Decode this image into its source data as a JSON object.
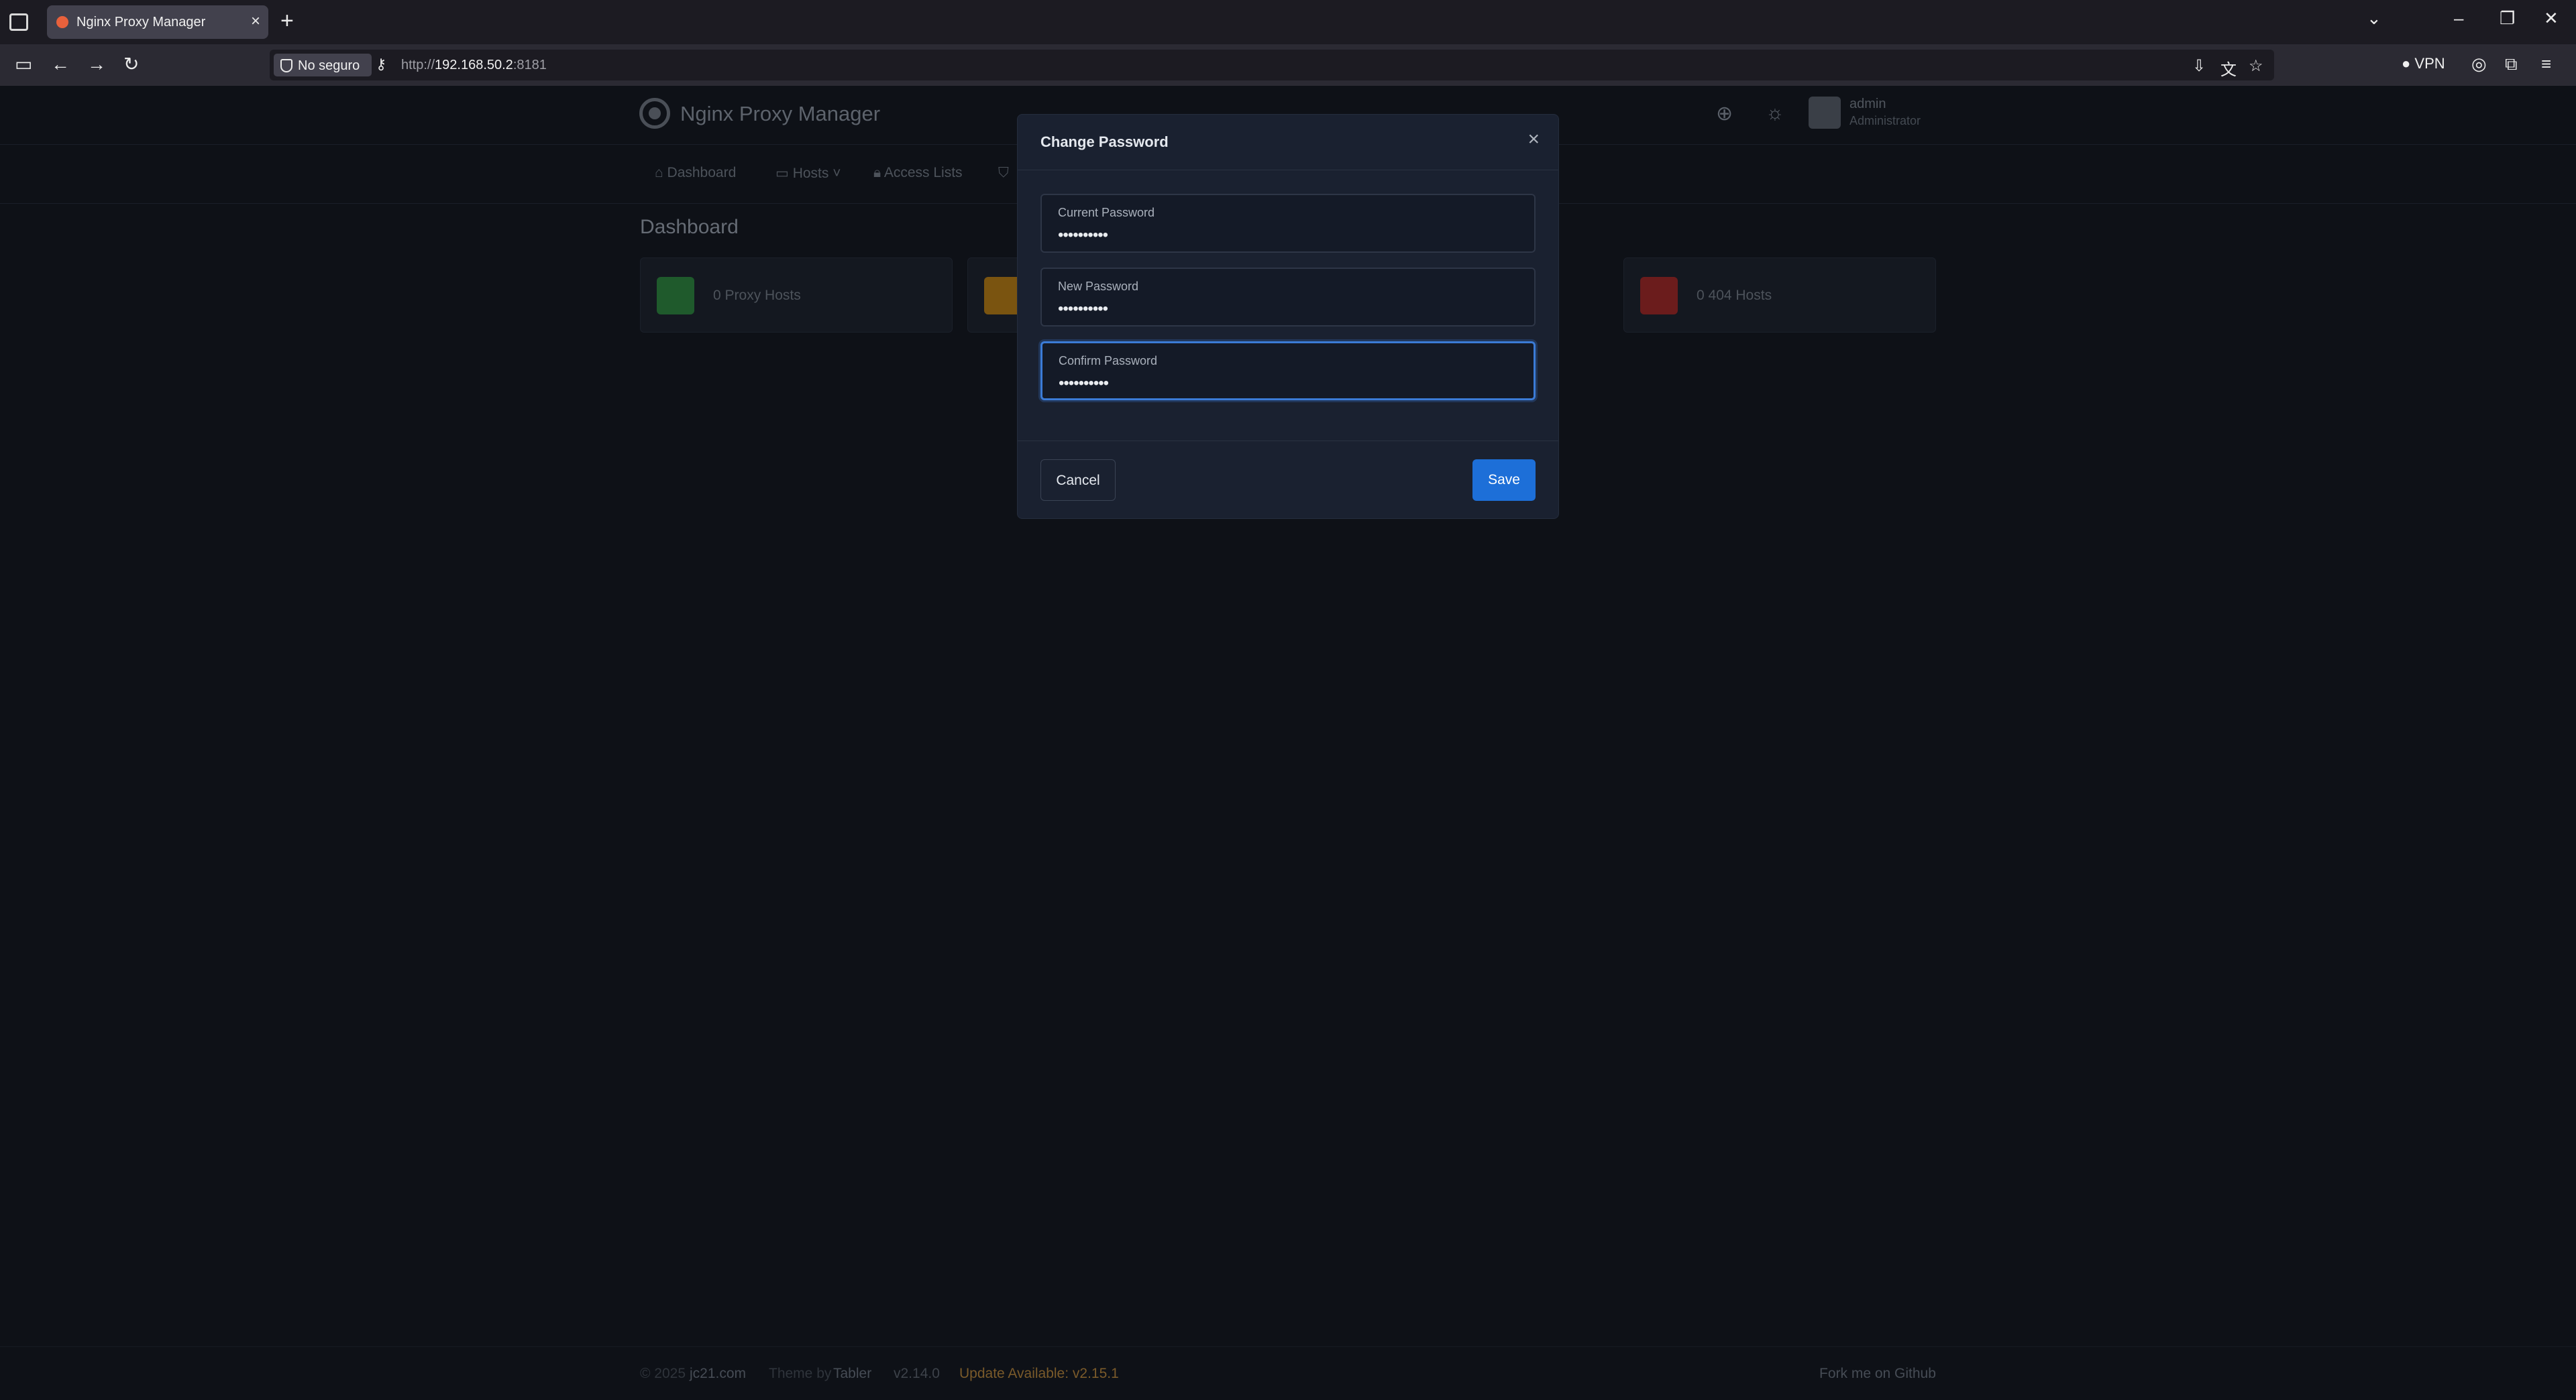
{
  "browser": {
    "tab_title": "Nginx Proxy Manager",
    "security_label": "No seguro",
    "url_prefix": "http://",
    "url_host": "192.168.50.2",
    "url_port": ":8181",
    "vpn_label": "VPN"
  },
  "app": {
    "brand": "Nginx Proxy Manager",
    "user_name": "admin",
    "user_role": "Administrator",
    "nav": [
      {
        "label": "Dashboard",
        "icon": "home-icon"
      },
      {
        "label": "Hosts",
        "icon": "monitor-icon"
      },
      {
        "label": "Access Lists",
        "icon": "lock-icon"
      }
    ],
    "page_title": "Dashboard",
    "stats": [
      {
        "label": "0 Proxy Hosts",
        "color": "#2f9e44",
        "icon": "bolt-icon"
      },
      {
        "label": "0 404 Hosts",
        "color": "#c92a2a",
        "icon": "no-entry-icon"
      }
    ]
  },
  "modal": {
    "title": "Change Password",
    "fields": [
      {
        "label": "Current Password",
        "value": "••••••••••"
      },
      {
        "label": "New Password",
        "value": "••••••••••"
      },
      {
        "label": "Confirm Password",
        "value": "••••••••••"
      }
    ],
    "cancel_label": "Cancel",
    "save_label": "Save",
    "accent": "#1d6fd8"
  },
  "footer": {
    "copyright": "© 2025",
    "site": "jc21.com",
    "theme_by": "Theme by",
    "theme_name": "Tabler",
    "version": "v2.14.0",
    "update": "Update Available: v2.15.1",
    "fork": "Fork me on Github"
  }
}
